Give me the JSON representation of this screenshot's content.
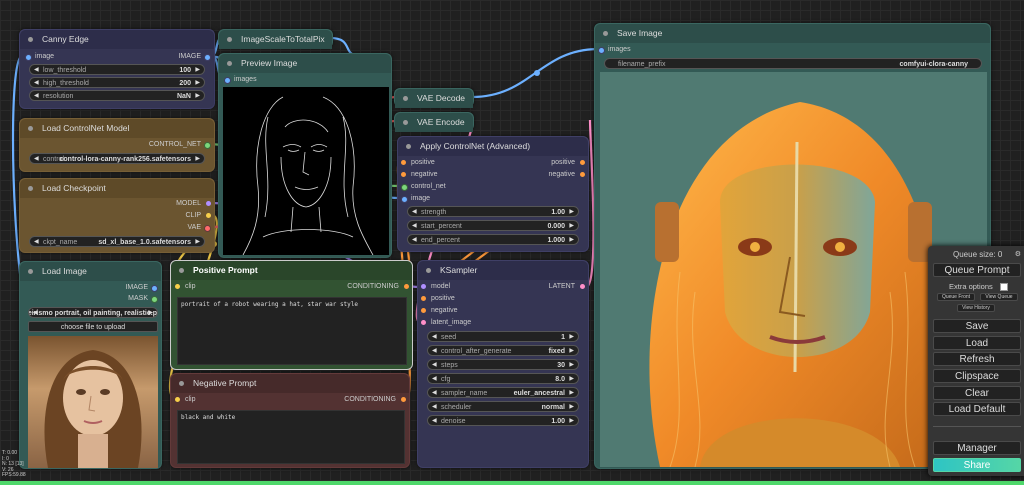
{
  "nodes": {
    "canny": {
      "title": "Canny Edge",
      "in_image": "image",
      "out_image": "IMAGE",
      "low_label": "low_threshold",
      "low_value": "100",
      "high_label": "high_threshold",
      "high_value": "200",
      "res_label": "resolution",
      "res_value": "NaN"
    },
    "scale": {
      "title": "ImageScaleToTotalPix"
    },
    "preview": {
      "title": "Preview Image",
      "in_images": "images"
    },
    "vae_decode": {
      "title": "VAE Decode"
    },
    "vae_encode": {
      "title": "VAE Encode"
    },
    "controlnet_loader": {
      "title": "Load ControlNet Model",
      "out": "CONTROL_NET",
      "label": "control",
      "value": "control-lora-canny-rank256.safetensors"
    },
    "checkpoint": {
      "title": "Load Checkpoint",
      "out_model": "MODEL",
      "out_clip": "CLIP",
      "out_vae": "VAE",
      "label": "ckpt_name",
      "value": "sd_xl_base_1.0.safetensors"
    },
    "apply_cn": {
      "title": "Apply ControlNet (Advanced)",
      "in_positive": "positive",
      "in_negative": "negative",
      "in_control": "control_net",
      "in_image": "image",
      "out_positive": "positive",
      "out_negative": "negative",
      "strength_label": "strength",
      "strength_value": "1.00",
      "start_label": "start_percent",
      "start_value": "0.000",
      "end_label": "end_percent",
      "end_value": "1.000"
    },
    "load_image": {
      "title": "Load Image",
      "out_image": "IMAGE",
      "out_mask": "MASK",
      "label": "image",
      "value": "Caveirismo portrait, oil painting, realistic.png",
      "upload": "choose file to upload"
    },
    "positive": {
      "title": "Positive Prompt",
      "in_clip": "clip",
      "out": "CONDITIONING",
      "text": "portrait of a robot wearing a hat, star war style"
    },
    "negative": {
      "title": "Negative Prompt",
      "in_clip": "clip",
      "out": "CONDITIONING",
      "text": "black and white"
    },
    "ksampler": {
      "title": "KSampler",
      "in_model": "model",
      "in_positive": "positive",
      "in_negative": "negative",
      "in_latent": "latent_image",
      "out": "LATENT",
      "w": [
        {
          "label": "seed",
          "value": "1"
        },
        {
          "label": "control_after_generate",
          "value": "fixed"
        },
        {
          "label": "steps",
          "value": "30"
        },
        {
          "label": "cfg",
          "value": "8.0"
        },
        {
          "label": "sampler_name",
          "value": "euler_ancestral"
        },
        {
          "label": "scheduler",
          "value": "normal"
        },
        {
          "label": "denoise",
          "value": "1.00"
        }
      ]
    },
    "save": {
      "title": "Save Image",
      "in_images": "images",
      "prefix_label": "filename_prefix",
      "prefix_value": "comfyui-clora-canny"
    }
  },
  "menu": {
    "queue_size": "Queue size: 0",
    "queue_prompt": "Queue Prompt",
    "extra_options": "Extra options",
    "queue_front": "Queue Front",
    "view_queue": "View Queue",
    "view_history": "View History",
    "save": "Save",
    "load": "Load",
    "refresh": "Refresh",
    "clipspace": "Clipspace",
    "clear": "Clear",
    "load_default": "Load Default",
    "manager": "Manager",
    "share": "Share"
  },
  "stats": {
    "t": "T: 0.00",
    "i": "I: 0",
    "n": "N: 13 [13]",
    "v": "V: 26",
    "fps": "FPS:59.88"
  },
  "colors": {
    "share": "#55d6a6",
    "accent_green": "#4fd86b"
  }
}
